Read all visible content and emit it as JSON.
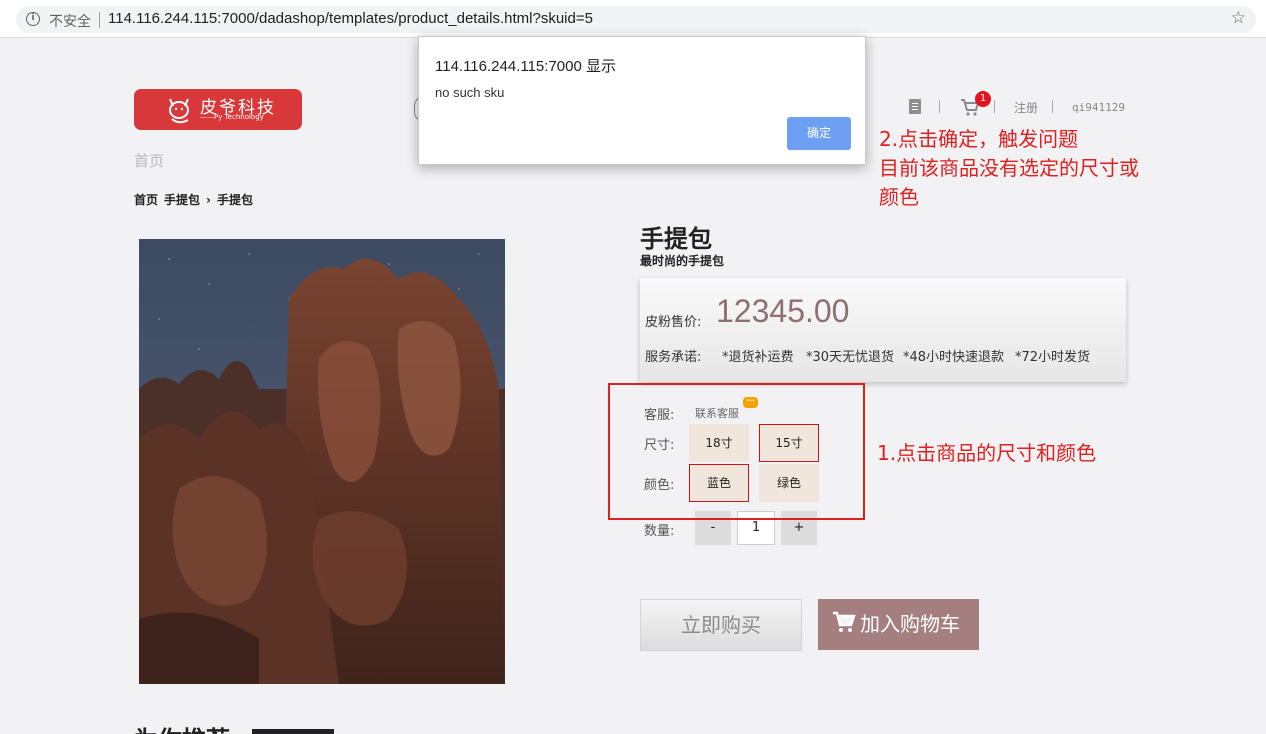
{
  "browser": {
    "security_label": "不安全",
    "url": "114.116.244.115:7000/dadashop/templates/product_details.html?skuid=5"
  },
  "header": {
    "logo_name": "皮爷科技",
    "logo_sub": "——Py Technology",
    "nav_home": "首页",
    "cart_count": "1",
    "register": "注册",
    "username": "qi941129"
  },
  "breadcrumb": {
    "items": [
      "首页",
      "手提包",
      "手提包"
    ],
    "separator": "›"
  },
  "product": {
    "title": "手提包",
    "subtitle": "最时尚的手提包",
    "price_label": "皮粉售价:",
    "price": "12345.00",
    "promise_label": "服务承诺:",
    "promises": [
      "*退货补运费",
      "*30天无忧退货",
      "*48小时快速退款",
      "*72小时发货"
    ]
  },
  "options": {
    "service_label": "客服:",
    "service_link": "联系客服",
    "service_icon": "chat-bubble-icon",
    "size_label": "尺寸:",
    "sizes": [
      {
        "label": "18寸",
        "selected": false
      },
      {
        "label": "15寸",
        "selected": true
      }
    ],
    "color_label": "颜色:",
    "colors": [
      {
        "label": "蓝色",
        "selected": true
      },
      {
        "label": "绿色",
        "selected": false
      }
    ],
    "qty_label": "数量:",
    "qty_minus": "-",
    "qty_value": "1",
    "qty_plus": "+"
  },
  "actions": {
    "buy_now": "立即购买",
    "add_to_cart": "加入购物车"
  },
  "recommend": {
    "title": "为你推荐"
  },
  "dialog": {
    "title": "114.116.244.115:7000 显示",
    "message": "no such sku",
    "ok": "确定"
  },
  "annotations": {
    "note1": "1.点击商品的尺寸和颜色",
    "note2_lines": [
      "2.点击确定，触发问题",
      "目前该商品没有选定的尺寸或",
      "颜色"
    ]
  },
  "colors": {
    "page_bg": "#f2f2f4",
    "logo_red": "#d9383a",
    "price": "#8e6f71",
    "add_cart_bg": "#a57f80",
    "annotation_red": "#e02020",
    "dialog_button": "#6d9ff2",
    "option_bg": "#f1e6dc"
  }
}
